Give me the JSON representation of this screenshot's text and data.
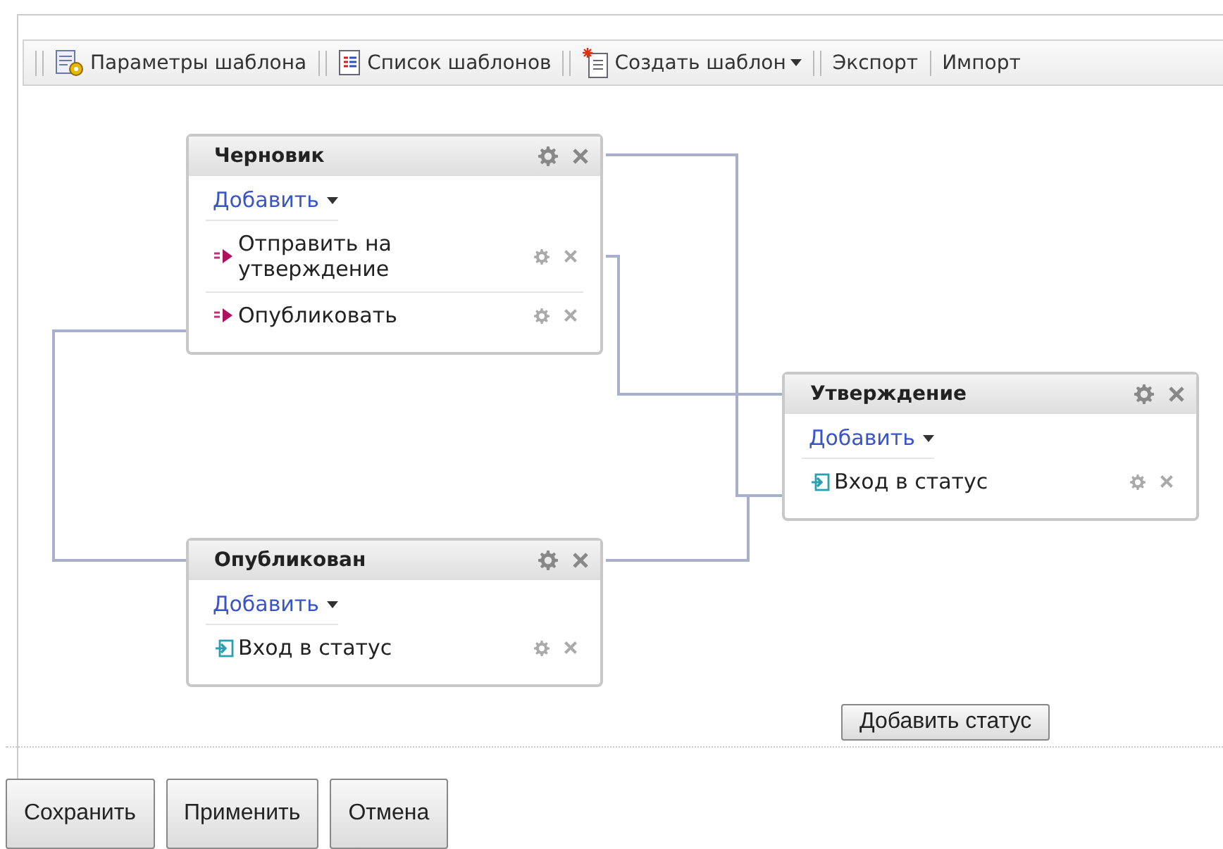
{
  "toolbar": [
    {
      "kind": "settings",
      "label": "Параметры шаблона",
      "menu": false
    },
    {
      "kind": "list",
      "label": "Список шаблонов",
      "menu": false
    },
    {
      "kind": "new",
      "label": "Создать шаблон",
      "menu": true
    },
    {
      "kind": "plain",
      "label": "Экспорт",
      "menu": false
    },
    {
      "kind": "plain",
      "label": "Импорт",
      "menu": false
    }
  ],
  "nodes": [
    {
      "title": "Черновик",
      "add_label": "Добавить",
      "actions": [
        {
          "kind": "transition",
          "label": "Отправить на утверждение"
        },
        {
          "kind": "transition",
          "label": "Опубликовать"
        }
      ]
    },
    {
      "title": "Утверждение",
      "add_label": "Добавить",
      "actions": [
        {
          "kind": "entry",
          "label": "Вход в статус"
        }
      ]
    },
    {
      "title": "Опубликован",
      "add_label": "Добавить",
      "actions": [
        {
          "kind": "entry",
          "label": "Вход в статус"
        }
      ]
    }
  ],
  "add_status_button": "Добавить статус",
  "buttons": [
    "Сохранить",
    "Применить",
    "Отмена"
  ]
}
